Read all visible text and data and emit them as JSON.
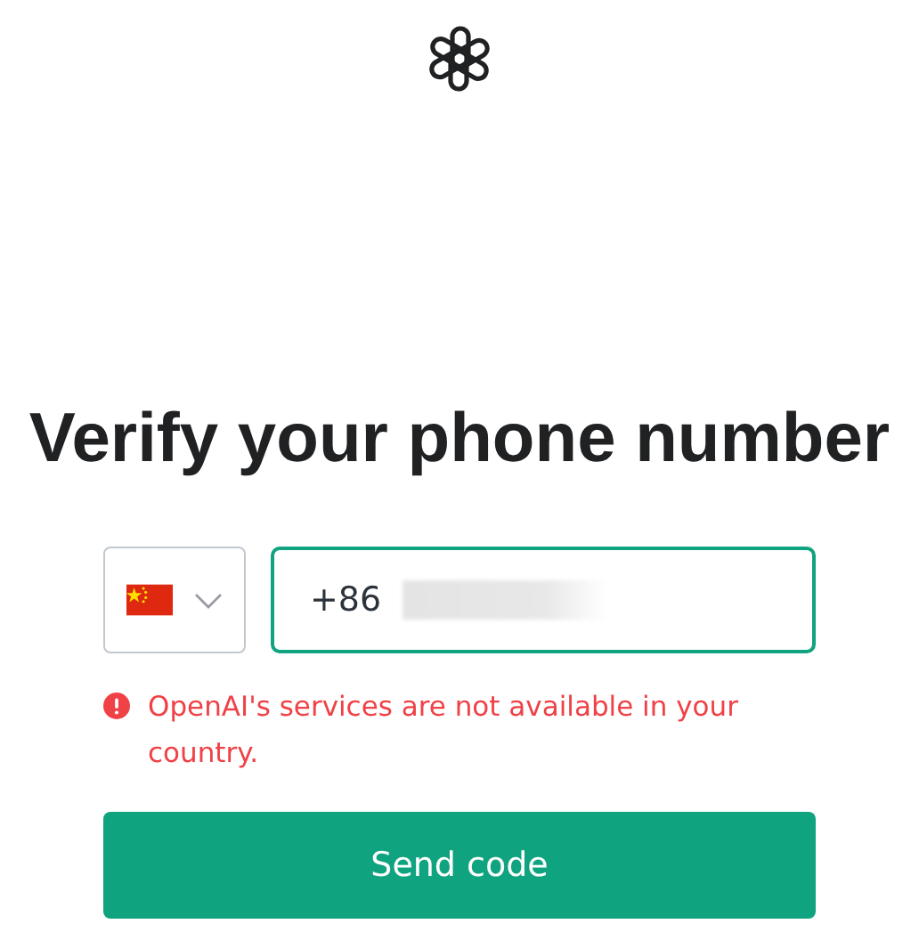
{
  "heading": "Verify your phone number",
  "phone_field": {
    "value": "+86"
  },
  "error": {
    "message": "OpenAI's services are not available in your country."
  },
  "buttons": [
    {
      "label": "Send code"
    }
  ]
}
